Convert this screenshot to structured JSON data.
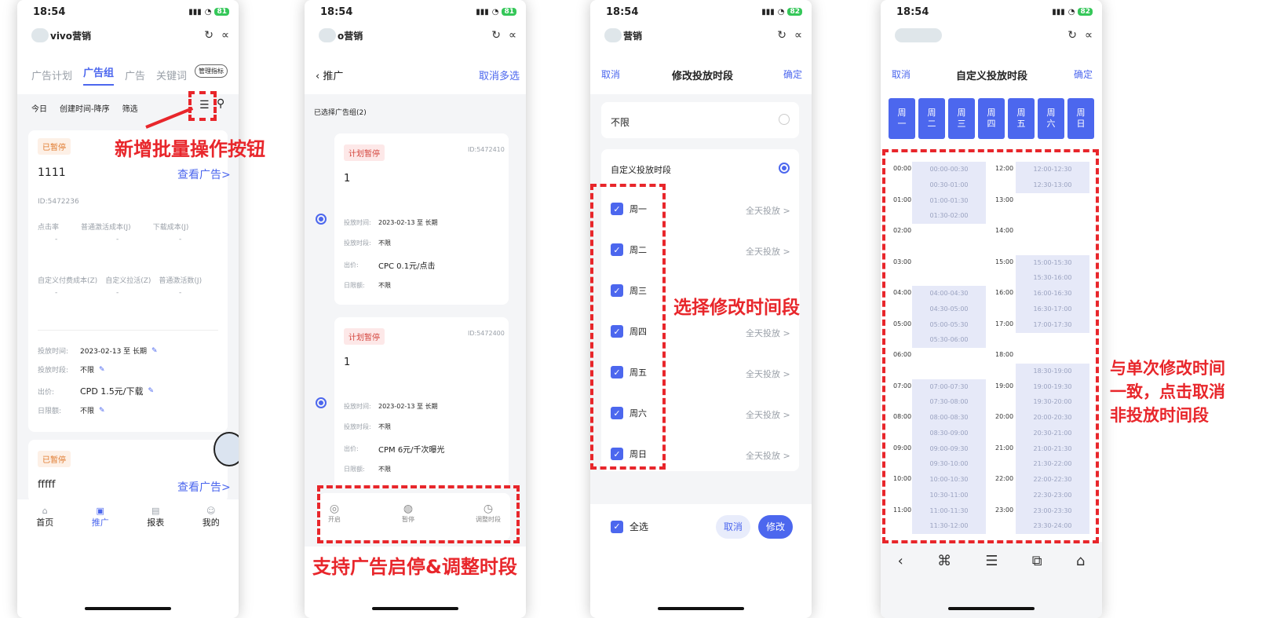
{
  "status": {
    "time": "18:54",
    "battery1": "81",
    "battery2": "81",
    "battery3": "82",
    "battery4": "82"
  },
  "app": {
    "title1": "vivo营销",
    "title2": "o营销",
    "title3": "营销"
  },
  "p1": {
    "tabs": [
      "广告计划",
      "广告组",
      "广告",
      "关键词"
    ],
    "manage": "管理指标",
    "filter": {
      "today": "今日",
      "sort": "创建时间-降序",
      "filter": "筛选"
    },
    "card1": {
      "tag": "已暂停",
      "name": "1111",
      "link": "查看广告>",
      "id": "ID:5472236",
      "metrics1": [
        "点击率",
        "普通激活成本(J)",
        "下载成本(J)"
      ],
      "metrics2": [
        "自定义付费成本(Z)",
        "自定义拉活(Z)",
        "普通激活数(J)"
      ],
      "dash": "-",
      "info": [
        {
          "k": "投放时间:",
          "v": "2023-02-13 至 长期"
        },
        {
          "k": "投放时段:",
          "v": "不限"
        },
        {
          "k": "出价:",
          "v": "CPD  1.5元/下载"
        },
        {
          "k": "日限额:",
          "v": "不限"
        }
      ]
    },
    "card2": {
      "tag": "已暂停",
      "name": "fffff",
      "link": "查看广告>"
    },
    "nav": [
      "首页",
      "推广",
      "报表",
      "我的"
    ],
    "ann": "新增批量操作按钮"
  },
  "p2": {
    "back": "推广",
    "cancel": "取消多选",
    "selected": "已选择广告组(2)",
    "cards": [
      {
        "tag": "计划暂停",
        "id": "ID:5472410",
        "name": "1",
        "info": [
          {
            "k": "投放时间:",
            "v": "2023-02-13 至 长期"
          },
          {
            "k": "投放时段:",
            "v": "不限"
          },
          {
            "k": "出价:",
            "v": "CPC  0.1元/点击"
          },
          {
            "k": "日限额:",
            "v": "不限"
          }
        ]
      },
      {
        "tag": "计划暂停",
        "id": "ID:5472400",
        "name": "1",
        "info": [
          {
            "k": "投放时间:",
            "v": "2023-02-13 至 长期"
          },
          {
            "k": "投放时段:",
            "v": "不限"
          },
          {
            "k": "出价:",
            "v": "CPM  6元/千次曝光"
          },
          {
            "k": "日限额:",
            "v": "不限"
          }
        ]
      }
    ],
    "actions": [
      "开启",
      "暂停",
      "调整时段"
    ],
    "ann": "支持广告启停&调整时段"
  },
  "p3": {
    "cancel": "取消",
    "title": "修改投放时段",
    "ok": "确定",
    "unlimited": "不限",
    "custom": "自定义投放时段",
    "days": [
      "周一",
      "周二",
      "周三",
      "周四",
      "周五",
      "周六",
      "周日"
    ],
    "allday": "全天投放 >",
    "selectall": "全选",
    "btn_cancel": "取消",
    "btn_modify": "修改",
    "ann": "选择修改时间段"
  },
  "p4": {
    "cancel": "取消",
    "title": "自定义投放时段",
    "ok": "确定",
    "days": [
      "周\n一",
      "周\n二",
      "周\n三",
      "周\n四",
      "周\n五",
      "周\n六",
      "周\n日"
    ],
    "hours_left": [
      "00:00",
      "01:00",
      "02:00",
      "03:00",
      "04:00",
      "05:00",
      "06:00",
      "07:00",
      "08:00",
      "09:00",
      "10:00",
      "11:00"
    ],
    "hours_right": [
      "12:00",
      "13:00",
      "14:00",
      "15:00",
      "16:00",
      "17:00",
      "18:00",
      "19:00",
      "20:00",
      "21:00",
      "22:00",
      "23:00"
    ],
    "slots_left": [
      "00:00-00:30",
      "00:30-01:00",
      "01:00-01:30",
      "01:30-02:00",
      "04:00-04:30",
      "04:30-05:00",
      "05:00-05:30",
      "05:30-06:00",
      "07:00-07:30",
      "07:30-08:00",
      "08:00-08:30",
      "08:30-09:00",
      "09:00-09:30",
      "09:30-10:00",
      "10:00-10:30",
      "10:30-11:00",
      "11:00-11:30",
      "11:30-12:00"
    ],
    "slots_right": [
      "12:00-12:30",
      "12:30-13:00",
      "15:00-15:30",
      "15:30-16:00",
      "16:00-16:30",
      "16:30-17:00",
      "17:00-17:30",
      "18:30-19:00",
      "19:00-19:30",
      "19:30-20:00",
      "20:00-20:30",
      "20:30-21:00",
      "21:00-21:30",
      "21:30-22:00",
      "22:00-22:30",
      "22:30-23:00",
      "23:00-23:30",
      "23:30-24:00"
    ],
    "ann": "与单次修改时间一致，点击取消非投放时间段"
  }
}
